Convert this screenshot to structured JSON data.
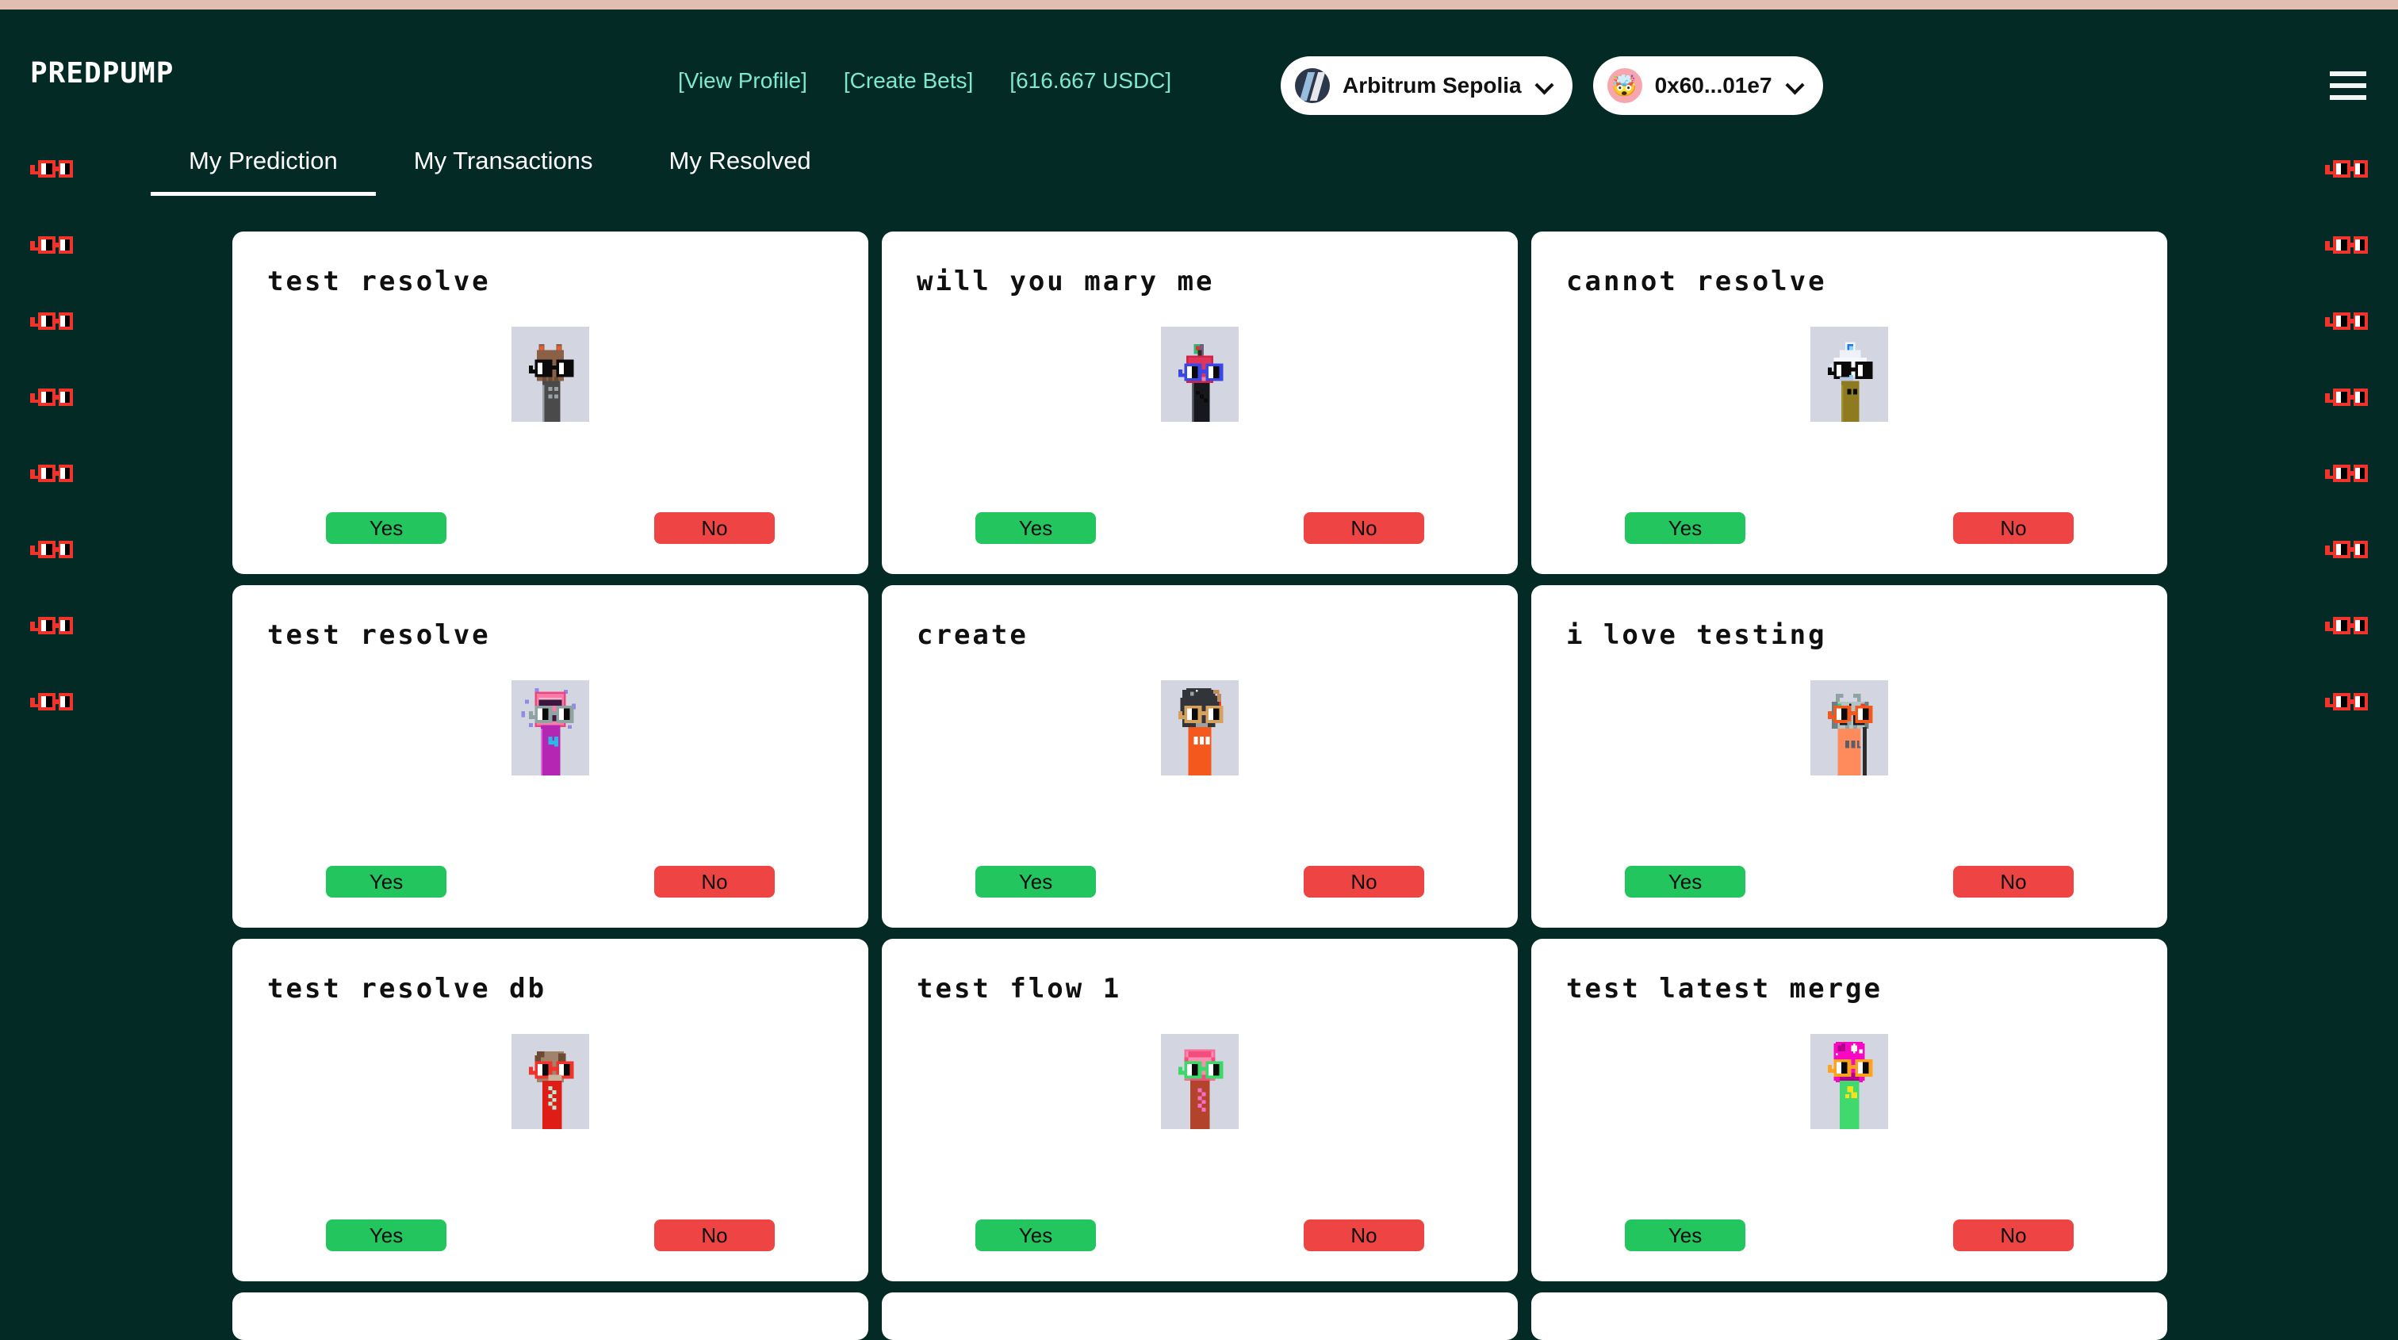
{
  "theme": {
    "background": "#042a25",
    "top_strip": "#e2beb1",
    "accent_mint": "#7fe8d0",
    "card_bg": "#ffffff",
    "yes_green": "#22c55e",
    "no_red": "#ef4444",
    "decor_red": "#f0342c"
  },
  "header": {
    "logo": "PREDPUMP",
    "nav_links": [
      {
        "label": "[View Profile]",
        "name": "view-profile-link"
      },
      {
        "label": "[Create Bets]",
        "name": "create-bets-link"
      },
      {
        "label": "[616.667 USDC]",
        "name": "balance-link"
      }
    ],
    "network_button": {
      "label": "Arbitrum Sepolia",
      "icon": "arbitrum-icon",
      "chevron": "chevron-down-icon"
    },
    "wallet_button": {
      "label": "0x60...01e7",
      "icon": "wallet-avatar-icon",
      "emoji": "🤯",
      "chevron": "chevron-down-icon"
    },
    "menu_icon": "hamburger-menu-icon"
  },
  "tabs": [
    {
      "label": "My Prediction",
      "active": true
    },
    {
      "label": "My Transactions",
      "active": false
    },
    {
      "label": "My Resolved",
      "active": false
    }
  ],
  "decor": {
    "icon": "pixel-sunglasses-icon",
    "left_count": 8,
    "right_count": 8
  },
  "buttons": {
    "yes": "Yes",
    "no": "No"
  },
  "cards": [
    {
      "title": "test resolve",
      "avatar": "pixel-bear-avatar",
      "yes": "Yes",
      "no": "No"
    },
    {
      "title": "will you mary me",
      "avatar": "pixel-apple-avatar",
      "yes": "Yes",
      "no": "No"
    },
    {
      "title": "cannot resolve",
      "avatar": "pixel-ghost-avatar",
      "yes": "Yes",
      "no": "No"
    },
    {
      "title": "test resolve",
      "avatar": "pixel-pink-avatar",
      "yes": "Yes",
      "no": "No"
    },
    {
      "title": "create",
      "avatar": "pixel-bomb-avatar",
      "yes": "Yes",
      "no": "No"
    },
    {
      "title": "i love testing",
      "avatar": "pixel-robot-avatar",
      "yes": "Yes",
      "no": "No"
    },
    {
      "title": "test resolve db",
      "avatar": "pixel-brown-avatar",
      "yes": "Yes",
      "no": "No"
    },
    {
      "title": "test flow 1",
      "avatar": "pixel-brain-avatar",
      "yes": "Yes",
      "no": "No"
    },
    {
      "title": "test latest merge",
      "avatar": "pixel-magenta-avatar",
      "yes": "Yes",
      "no": "No"
    }
  ]
}
